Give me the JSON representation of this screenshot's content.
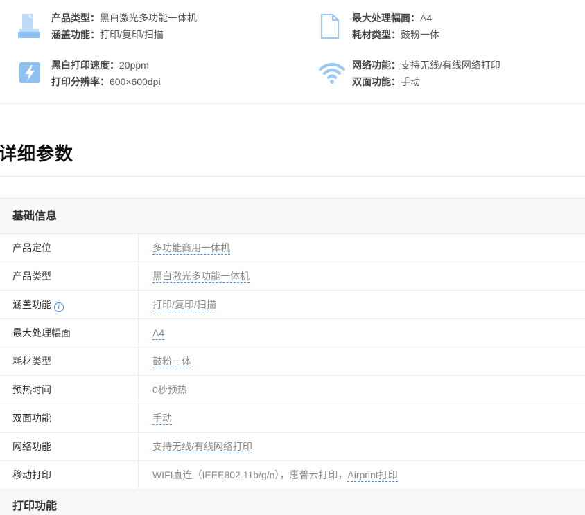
{
  "summary": {
    "specs": [
      {
        "icon": "printer-icon",
        "line1_key": "产品类型：",
        "line1_val": "黑白激光多功能一体机",
        "line2_key": "涵盖功能：",
        "line2_val": "打印/复印/扫描"
      },
      {
        "icon": "paper-icon",
        "line1_key": "最大处理幅面：",
        "line1_val": "A4",
        "line2_key": "耗材类型：",
        "line2_val": "鼓粉一体"
      },
      {
        "icon": "lightning-icon",
        "line1_key": "黑白打印速度：",
        "line1_val": "20ppm",
        "line2_key": "打印分辨率：",
        "line2_val": "600×600dpi"
      },
      {
        "icon": "wifi-icon",
        "line1_key": "网络功能：",
        "line1_val": "支持无线/有线网络打印",
        "line2_key": "双面功能：",
        "line2_val": "手动"
      }
    ]
  },
  "section_title": "详细参数",
  "groups": [
    {
      "title": "基础信息",
      "rows": [
        {
          "key": "产品定位",
          "value": "多功能商用一体机"
        },
        {
          "key": "产品类型",
          "value": "黑白激光多功能一体机"
        },
        {
          "key": "涵盖功能",
          "value": "打印/复印/扫描",
          "info": "i"
        },
        {
          "key": "最大处理幅面",
          "value": "A4"
        },
        {
          "key": "耗材类型",
          "value": "鼓粉一体"
        },
        {
          "key": "预热时间",
          "value": "0秒预热"
        },
        {
          "key": "双面功能",
          "value": "手动"
        },
        {
          "key": "网络功能",
          "value": "支持无线/有线网络打印"
        },
        {
          "key": "移动打印",
          "value_plain": "WIFI直连（IEEE802.11b/g/n），惠普云打印，",
          "value": "Airprint打印"
        }
      ]
    },
    {
      "title": "打印功能"
    }
  ],
  "colors": {
    "accent": "#4a90e2",
    "icon_blue": "#9cc7f3",
    "group_bg": "#f7f7f7"
  }
}
